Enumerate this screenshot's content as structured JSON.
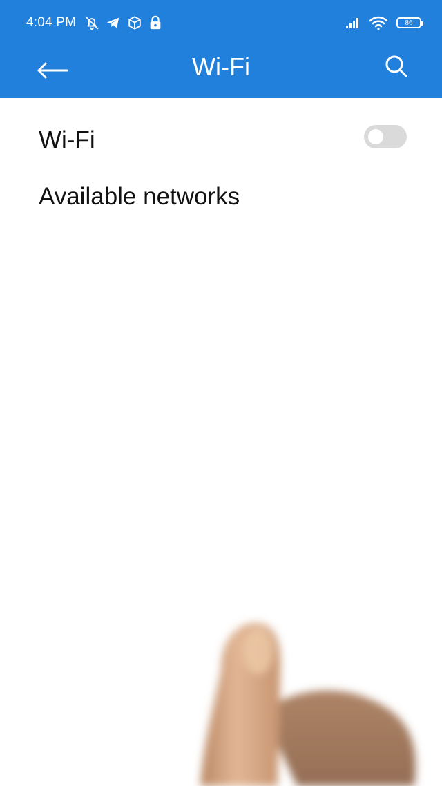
{
  "status_bar": {
    "time": "4:04 PM",
    "left_icons": [
      "bell-off-icon",
      "telegram-icon",
      "package-icon",
      "lock-icon"
    ],
    "right_icons": [
      "cellular-signal-icon",
      "wifi-signal-icon",
      "battery-icon"
    ],
    "battery_level": "86"
  },
  "app_bar": {
    "title": "Wi-Fi",
    "back_icon": "arrow-left-icon",
    "search_icon": "search-icon",
    "background_color": "#2280dd"
  },
  "settings": {
    "wifi_label": "Wi-Fi",
    "wifi_enabled": false,
    "available_networks_header": "Available networks"
  },
  "colors": {
    "accent": "#2280dd",
    "toggle_off": "#dadada",
    "text_primary": "#111111"
  }
}
